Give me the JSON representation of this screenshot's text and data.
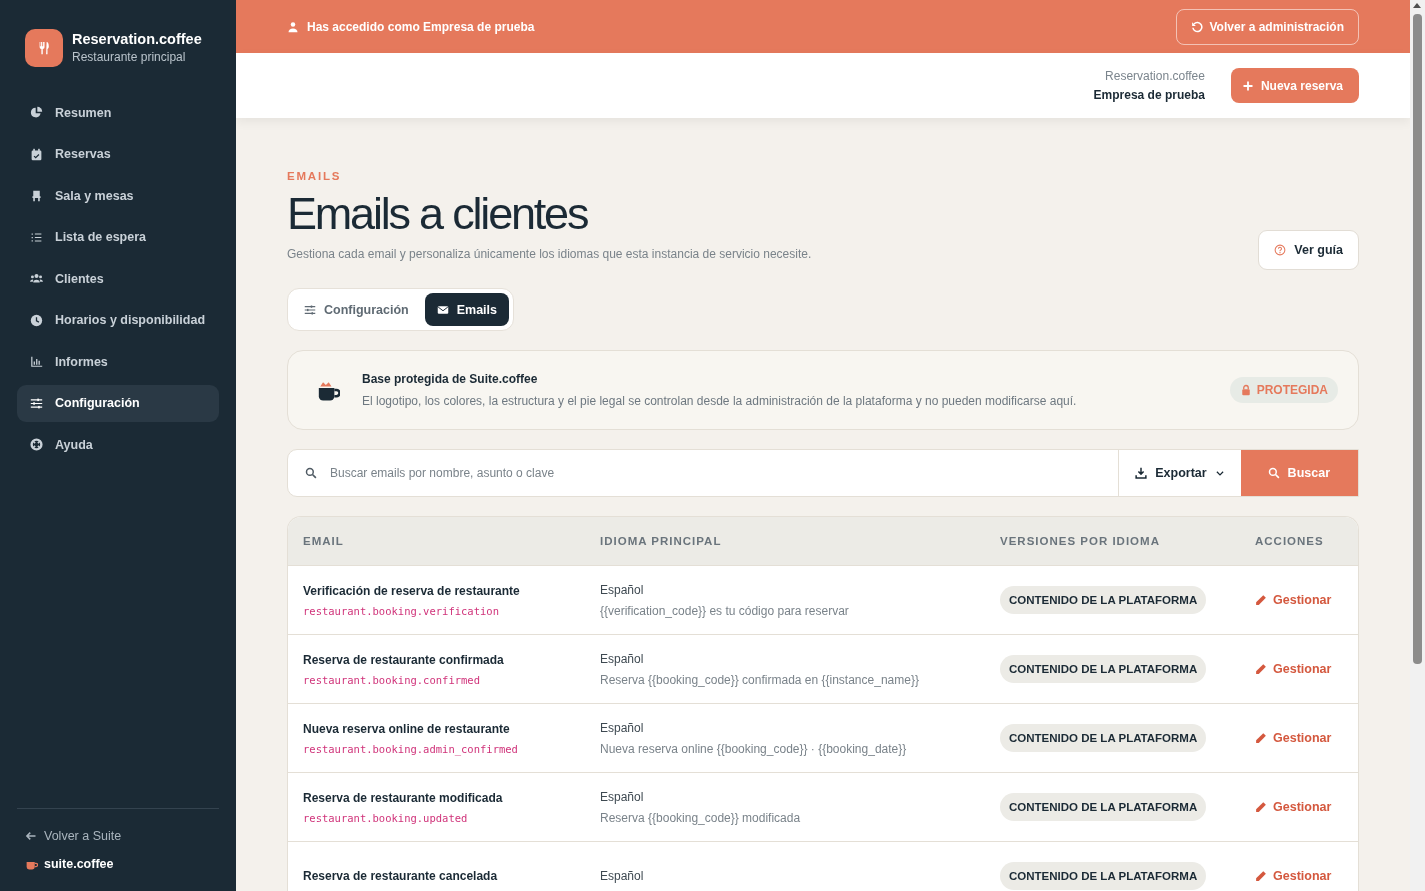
{
  "sidebar": {
    "brand": {
      "name": "Reservation.coffee",
      "subtitle": "Restaurante principal"
    },
    "items": [
      {
        "label": "Resumen",
        "selected": false
      },
      {
        "label": "Reservas",
        "selected": false
      },
      {
        "label": "Sala y mesas",
        "selected": false
      },
      {
        "label": "Lista de espera",
        "selected": false
      },
      {
        "label": "Clientes",
        "selected": false
      },
      {
        "label": "Horarios y disponibilidad",
        "selected": false
      },
      {
        "label": "Informes",
        "selected": false
      },
      {
        "label": "Configuración",
        "selected": true
      },
      {
        "label": "Ayuda",
        "selected": false
      }
    ],
    "footer": {
      "back_link": "Volver a Suite",
      "brand": "suite.coffee"
    }
  },
  "banner": {
    "message": "Has accedido como Empresa de prueba",
    "button": "Volver a administración"
  },
  "header": {
    "app_name": "Reservation.coffee",
    "company": "Empresa de prueba",
    "new_button": "Nueva reserva"
  },
  "page": {
    "eyebrow": "EMAILS",
    "title": "Emails a clientes",
    "description": "Gestiona cada email y personaliza únicamente los idiomas que esta instancia de servicio necesite.",
    "guide_button": "Ver guía"
  },
  "tabs": [
    {
      "label": "Configuración",
      "selected": false
    },
    {
      "label": "Emails",
      "selected": true
    }
  ],
  "notice": {
    "title": "Base protegida de Suite.coffee",
    "text": "El logotipo, los colores, la estructura y el pie legal se controlan desde la administración de la plataforma y no pueden modificarse aquí.",
    "badge": "PROTEGIDA"
  },
  "search": {
    "placeholder": "Buscar emails por nombre, asunto o clave",
    "export_button": "Exportar",
    "search_button": "Buscar"
  },
  "table": {
    "columns": [
      "EMAIL",
      "IDIOMA PRINCIPAL",
      "VERSIONES POR IDIOMA",
      "ACCIONES"
    ],
    "rows": [
      {
        "name": "Verificación de reserva de restaurante",
        "key": "restaurant.booking.verification",
        "language": "Español",
        "subject": "{{verification_code}} es tu código para reservar",
        "versions": "CONTENIDO DE LA PLATAFORMA",
        "action": "Gestionar"
      },
      {
        "name": "Reserva de restaurante confirmada",
        "key": "restaurant.booking.confirmed",
        "language": "Español",
        "subject": "Reserva {{booking_code}} confirmada en {{instance_name}}",
        "versions": "CONTENIDO DE LA PLATAFORMA",
        "action": "Gestionar"
      },
      {
        "name": "Nueva reserva online de restaurante",
        "key": "restaurant.booking.admin_confirmed",
        "language": "Español",
        "subject": "Nueva reserva online {{booking_code}} · {{booking_date}}",
        "versions": "CONTENIDO DE LA PLATAFORMA",
        "action": "Gestionar"
      },
      {
        "name": "Reserva de restaurante modificada",
        "key": "restaurant.booking.updated",
        "language": "Español",
        "subject": "Reserva {{booking_code}} modificada",
        "versions": "CONTENIDO DE LA PLATAFORMA",
        "action": "Gestionar"
      },
      {
        "name": "Reserva de restaurante cancelada",
        "language": "Español",
        "versions": "CONTENIDO DE LA PLATAFORMA",
        "action": "Gestionar"
      }
    ]
  }
}
